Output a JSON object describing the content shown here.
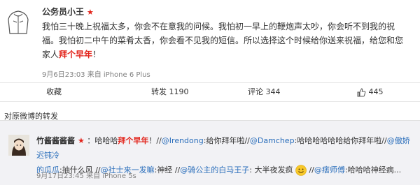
{
  "post": {
    "author": "公务员小王",
    "star": "★",
    "text_line1": "我怕三十晚上祝福太多，你会不在意我的问候。我怕初一早上的鞭炮声太吵，你会听不到我的祝",
    "text_line2": "福。我怕初二中午的菜肴太香，你会看不见我的短信。所以选择这个时候给你送来祝福，给您和您",
    "text_line3_a": "家人",
    "text_line3_hl": "拜个早年",
    "text_line3_b": "！",
    "meta": "9月6日23:03 来自 iPhone 6 Plus"
  },
  "actions": {
    "favorite": "收藏",
    "repost": "转发 1190",
    "comment": "评论 344",
    "like": "445"
  },
  "repost_section": {
    "header": "对原微博的转发",
    "author": "竹酱酱酱酱",
    "star": "★",
    "seg1": "：哈哈哈",
    "hl": "拜个早年",
    "seg2": "！//",
    "link1": "@Irendong",
    "seg3": ":给你拜年啦//",
    "link2": "@Damchep",
    "seg4": ":哈哈哈哈哈哈给你拜年啦//",
    "link3": "@傲娇迟钝冷",
    "link3b": "的瓜瓜",
    "seg5": ":抽什么风 //",
    "link4": "@社士来一发嘛",
    "seg6": ":神经 //",
    "link5": "@骑公主的白马王子",
    "seg7": ": 大半夜发疯",
    "seg8": " //",
    "link6": "@痞师傅",
    "seg9": ":哈哈哈神经病...",
    "meta": "9月17日23:45 来自 iPhone 5s"
  }
}
